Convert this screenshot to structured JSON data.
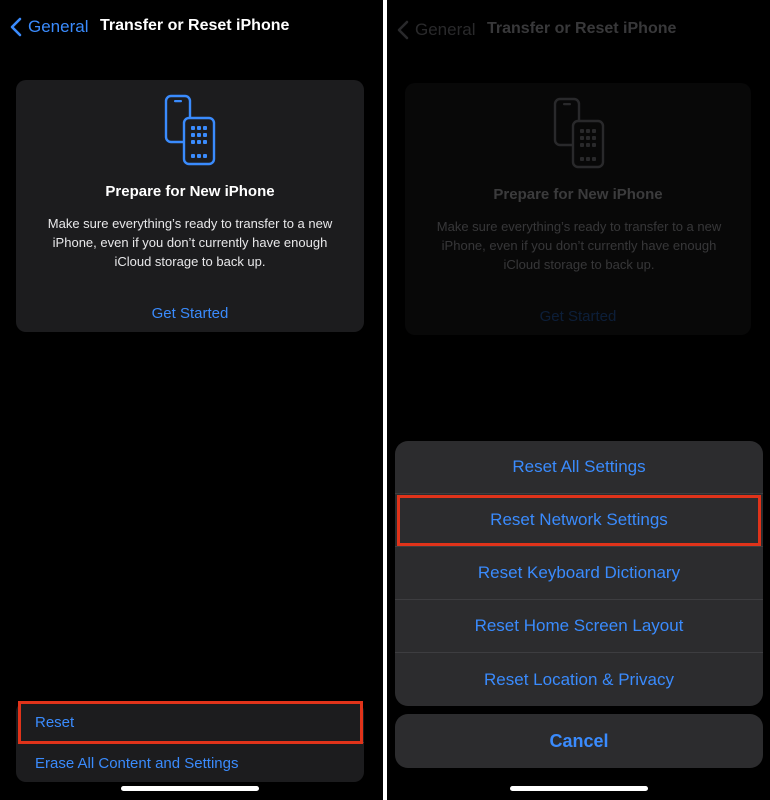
{
  "left": {
    "nav": {
      "back_label": "General",
      "title": "Transfer or Reset iPhone"
    },
    "card": {
      "icon": "phones-transfer-icon",
      "title": "Prepare for New iPhone",
      "body": "Make sure everything’s ready to transfer to a new iPhone, even if you don’t currently have enough iCloud storage to back up.",
      "link": "Get Started"
    },
    "list": {
      "items": [
        {
          "label": "Reset"
        },
        {
          "label": "Erase All Content and Settings"
        }
      ]
    }
  },
  "right": {
    "nav": {
      "back_label": "General",
      "title": "Transfer or Reset iPhone"
    },
    "card": {
      "title": "Prepare for New iPhone",
      "body": "Make sure everything’s ready to transfer to a new iPhone, even if you don’t currently have enough iCloud storage to back up.",
      "link": "Get Started"
    },
    "action_sheet": {
      "items": [
        {
          "label": "Reset All Settings"
        },
        {
          "label": "Reset Network Settings"
        },
        {
          "label": "Reset Keyboard Dictionary"
        },
        {
          "label": "Reset Home Screen Layout"
        },
        {
          "label": "Reset Location & Privacy"
        }
      ],
      "cancel_label": "Cancel"
    }
  },
  "colors": {
    "accent": "#3a8bfd",
    "highlight": "#e0331a",
    "card_bg": "#1c1c1e",
    "sheet_bg": "#2c2c2e"
  }
}
